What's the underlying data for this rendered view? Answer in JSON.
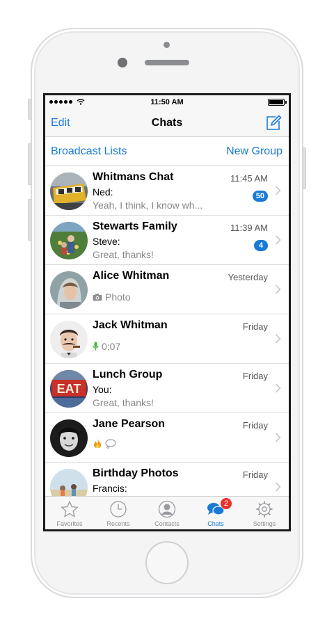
{
  "status_bar": {
    "time": "11:50 AM"
  },
  "nav": {
    "edit_label": "Edit",
    "title": "Chats"
  },
  "actions": {
    "broadcast_label": "Broadcast Lists",
    "new_group_label": "New Group"
  },
  "chats": [
    {
      "name": "Whitmans Chat",
      "time": "11:45 AM",
      "sender": "Ned:",
      "message": "Yeah, I think, I know wh...",
      "unread": "50"
    },
    {
      "name": "Stewarts Family",
      "time": "11:39 AM",
      "sender": "Steve:",
      "message": "Great, thanks!",
      "unread": "4"
    },
    {
      "name": "Alice Whitman",
      "time": "Yesterday",
      "message_icon": "camera-icon",
      "message": "Photo"
    },
    {
      "name": "Jack Whitman",
      "time": "Friday",
      "message_icon": "microphone-icon",
      "message": "0:07"
    },
    {
      "name": "Lunch Group",
      "time": "Friday",
      "sender": "You:",
      "message": "Great, thanks!"
    },
    {
      "name": "Jane Pearson",
      "time": "Friday",
      "message_icons": [
        "fire-emoji-icon",
        "speech-bubble-emoji-icon"
      ]
    },
    {
      "name": "Birthday Photos",
      "time": "Friday",
      "sender": "Francis:"
    }
  ],
  "tabs": [
    {
      "label": "Favorites",
      "icon": "star-icon"
    },
    {
      "label": "Recents",
      "icon": "clock-icon"
    },
    {
      "label": "Contacts",
      "icon": "person-icon"
    },
    {
      "label": "Chats",
      "icon": "chat-bubbles-icon",
      "active": true,
      "badge": "2"
    },
    {
      "label": "Settings",
      "icon": "gear-icon"
    }
  ],
  "colors": {
    "accent": "#1a7bd6",
    "badge_red": "#e8332c",
    "separator": "#dcdcde"
  }
}
